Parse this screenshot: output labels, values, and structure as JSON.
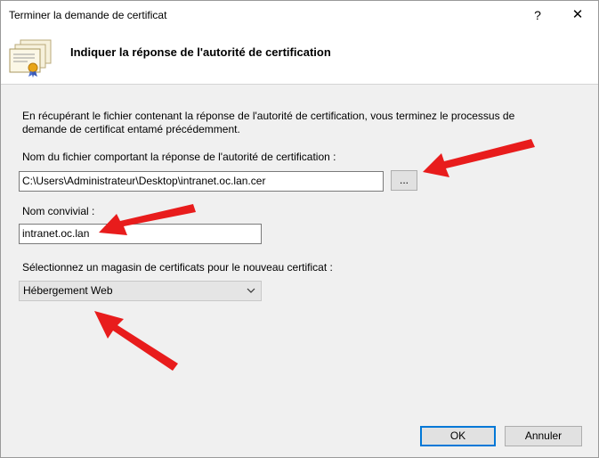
{
  "window": {
    "title": "Terminer la demande de certificat",
    "help_label": "?",
    "close_label": "✕"
  },
  "header": {
    "title": "Indiquer la réponse de l'autorité de certification",
    "icon": "certificate-stack-icon"
  },
  "form": {
    "intro_line1": "En récupérant le fichier contenant la réponse de l'autorité de certification, vous terminez le processus de",
    "intro_line2": "demande de certificat entamé précédemment.",
    "file_label": "Nom du fichier comportant la réponse de l'autorité de certification :",
    "file_value": "C:\\Users\\Administrateur\\Desktop\\intranet.oc.lan.cer",
    "browse_label": "...",
    "friendly_label": "Nom convivial :",
    "friendly_value": "intranet.oc.lan",
    "store_label": "Sélectionnez un magasin de certificats pour le nouveau certificat :",
    "store_value": "Hébergement Web"
  },
  "footer": {
    "ok_label": "OK",
    "cancel_label": "Annuler"
  },
  "colors": {
    "annotation_arrow": "#e81c1c",
    "default_button_border": "#0078d7"
  }
}
